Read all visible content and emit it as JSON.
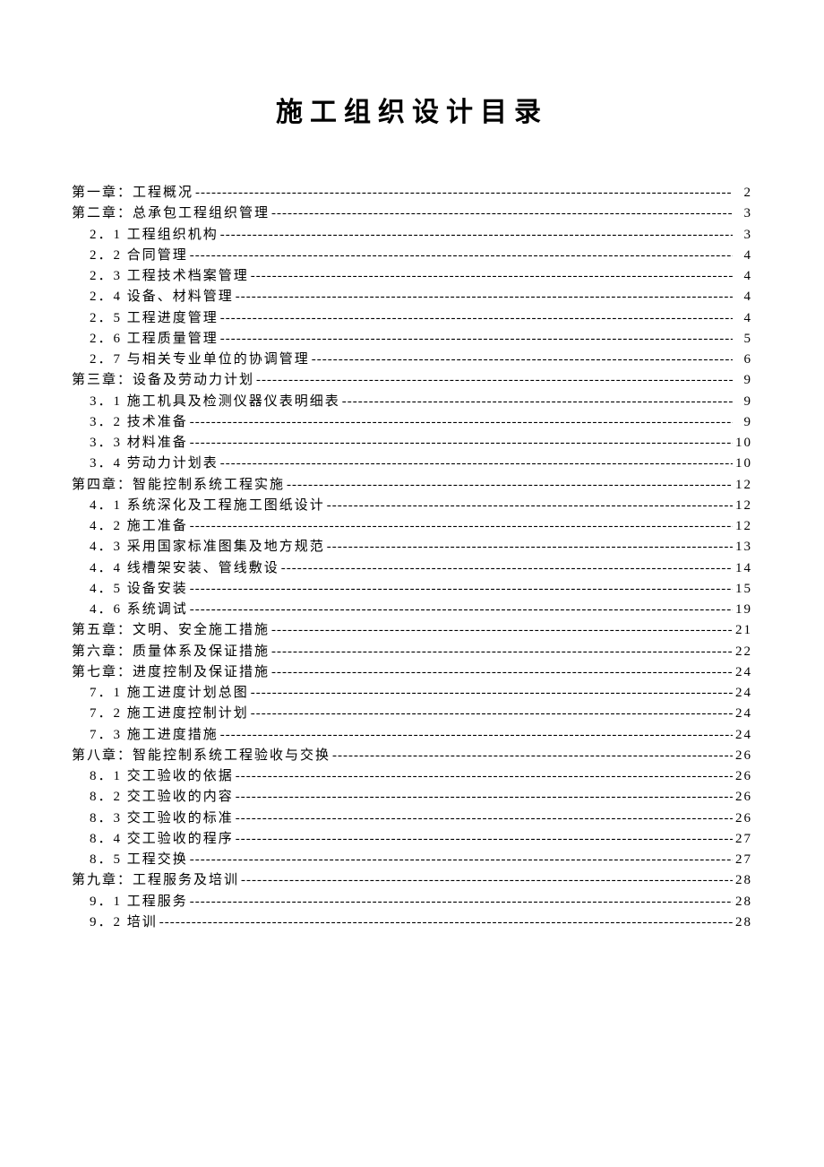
{
  "title": "施工组织设计目录",
  "toc": [
    {
      "level": 1,
      "label": "第一章：工程概况",
      "page": "2"
    },
    {
      "level": 1,
      "label": "第二章：总承包工程组织管理",
      "page": "3"
    },
    {
      "level": 2,
      "label": "2．1 工程组织机构",
      "page": "3"
    },
    {
      "level": 2,
      "label": "2．2 合同管理",
      "page": "4"
    },
    {
      "level": 2,
      "label": "2．3 工程技术档案管理",
      "page": "4"
    },
    {
      "level": 2,
      "label": "2．4 设备、材料管理",
      "page": "4"
    },
    {
      "level": 2,
      "label": "2．5 工程进度管理",
      "page": "4"
    },
    {
      "level": 2,
      "label": "2．6 工程质量管理",
      "page": "5"
    },
    {
      "level": 2,
      "label": "2．7 与相关专业单位的协调管理",
      "page": "6"
    },
    {
      "level": 1,
      "label": "第三章：设备及劳动力计划",
      "page": "9"
    },
    {
      "level": 2,
      "label": "3．1 施工机具及检测仪器仪表明细表",
      "page": "9"
    },
    {
      "level": 2,
      "label": "3．2 技术准备",
      "page": "9"
    },
    {
      "level": 2,
      "label": "3．3 材料准备",
      "page": "10"
    },
    {
      "level": 2,
      "label": "3．4 劳动力计划表",
      "page": "10"
    },
    {
      "level": 1,
      "label": "第四章：智能控制系统工程实施",
      "page": "12"
    },
    {
      "level": 2,
      "label": "4．1 系统深化及工程施工图纸设计",
      "page": "12"
    },
    {
      "level": 2,
      "label": "4．2 施工准备",
      "page": "12"
    },
    {
      "level": 2,
      "label": "4．3 采用国家标准图集及地方规范",
      "page": "13"
    },
    {
      "level": 2,
      "label": "4．4 线槽架安装、管线敷设",
      "page": "14"
    },
    {
      "level": 2,
      "label": "4．5 设备安装",
      "page": "15"
    },
    {
      "level": 2,
      "label": "4．6 系统调试",
      "page": "19"
    },
    {
      "level": 1,
      "label": "第五章：文明、安全施工措施",
      "page": "21"
    },
    {
      "level": 1,
      "label": "第六章：质量体系及保证措施",
      "page": "22"
    },
    {
      "level": 1,
      "label": "第七章：进度控制及保证措施",
      "page": "24"
    },
    {
      "level": 2,
      "label": "7．1 施工进度计划总图",
      "page": "24"
    },
    {
      "level": 2,
      "label": "7．2 施工进度控制计划",
      "page": "24"
    },
    {
      "level": 2,
      "label": "7．3 施工进度措施",
      "page": "24"
    },
    {
      "level": 1,
      "label": "第八章：智能控制系统工程验收与交换",
      "page": "26"
    },
    {
      "level": 2,
      "label": "8．1 交工验收的依据",
      "page": "26"
    },
    {
      "level": 2,
      "label": "8．2 交工验收的内容",
      "page": "26"
    },
    {
      "level": 2,
      "label": "8．3 交工验收的标准",
      "page": "26"
    },
    {
      "level": 2,
      "label": "8．4 交工验收的程序",
      "page": "27"
    },
    {
      "level": 2,
      "label": "8．5 工程交换",
      "page": "27"
    },
    {
      "level": 1,
      "label": "第九章：工程服务及培训",
      "page": "28"
    },
    {
      "level": 2,
      "label": "9．1 工程服务",
      "page": "28"
    },
    {
      "level": 2,
      "label": "9．2 培训",
      "page": "28"
    }
  ]
}
